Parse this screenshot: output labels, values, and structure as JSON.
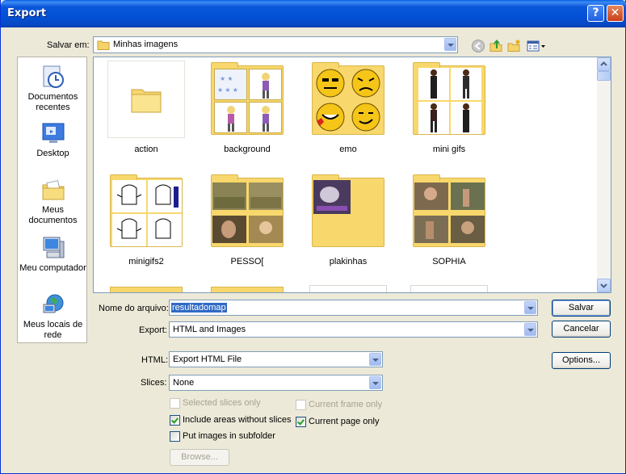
{
  "window": {
    "title": "Export"
  },
  "titlebar": {
    "help_label": "?",
    "close_label": "✕"
  },
  "location": {
    "label": "Salvar em:",
    "value": "Minhas imagens"
  },
  "toolbar": {
    "icons": [
      "back-icon",
      "up-folder-icon",
      "new-folder-icon",
      "view-menu-icon"
    ]
  },
  "places": [
    {
      "label": "Documentos recentes",
      "icon": "recent-documents-icon"
    },
    {
      "label": "Desktop",
      "icon": "desktop-icon"
    },
    {
      "label": "Meus documentos",
      "icon": "my-documents-icon"
    },
    {
      "label": "Meu computador",
      "icon": "my-computer-icon"
    },
    {
      "label": "Meus locais de rede",
      "icon": "network-places-icon"
    }
  ],
  "files": [
    {
      "name": "action"
    },
    {
      "name": "background"
    },
    {
      "name": "emo"
    },
    {
      "name": "mini gifs"
    },
    {
      "name": "minigifs2"
    },
    {
      "name": "PESSO["
    },
    {
      "name": "plakinhas"
    },
    {
      "name": "SOPHIA"
    }
  ],
  "form": {
    "filename_label": "Nome do arquivo:",
    "filename_value": "resultadomap",
    "export_label": "Export:",
    "export_value": "HTML and Images",
    "html_label": "HTML:",
    "html_value": "Export HTML File",
    "slices_label": "Slices:",
    "slices_value": "None"
  },
  "buttons": {
    "save": "Salvar",
    "cancel": "Cancelar",
    "options": "Options...",
    "browse": "Browse..."
  },
  "checkboxes": {
    "selected_slices_only": {
      "label": "Selected slices only",
      "checked": false,
      "enabled": false
    },
    "current_frame_only": {
      "label": "Current frame only",
      "checked": false,
      "enabled": false
    },
    "include_areas": {
      "label": "Include areas without slices",
      "checked": true,
      "enabled": true
    },
    "current_page_only": {
      "label": "Current page only",
      "checked": true,
      "enabled": true
    },
    "put_images_subfolder": {
      "label": "Put images in subfolder",
      "checked": false,
      "enabled": true
    }
  },
  "colors": {
    "title_bar": "#0a56d8",
    "dialog_bg": "#ece9d8",
    "folder": "#f8d86c",
    "selection": "#316ac5"
  }
}
